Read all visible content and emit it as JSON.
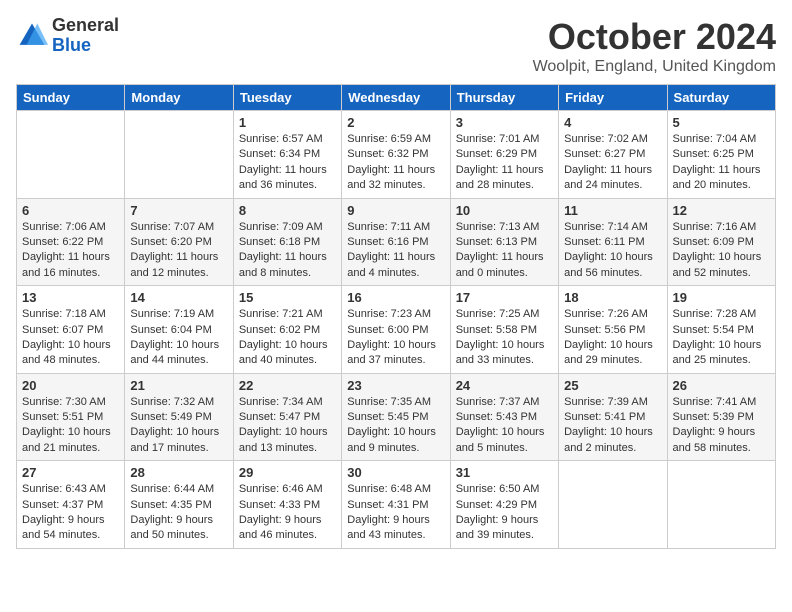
{
  "logo": {
    "general": "General",
    "blue": "Blue"
  },
  "title": {
    "month": "October 2024",
    "location": "Woolpit, England, United Kingdom"
  },
  "days_of_week": [
    "Sunday",
    "Monday",
    "Tuesday",
    "Wednesday",
    "Thursday",
    "Friday",
    "Saturday"
  ],
  "weeks": [
    [
      {
        "day": "",
        "info": ""
      },
      {
        "day": "",
        "info": ""
      },
      {
        "day": "1",
        "sunrise": "Sunrise: 6:57 AM",
        "sunset": "Sunset: 6:34 PM",
        "daylight": "Daylight: 11 hours and 36 minutes."
      },
      {
        "day": "2",
        "sunrise": "Sunrise: 6:59 AM",
        "sunset": "Sunset: 6:32 PM",
        "daylight": "Daylight: 11 hours and 32 minutes."
      },
      {
        "day": "3",
        "sunrise": "Sunrise: 7:01 AM",
        "sunset": "Sunset: 6:29 PM",
        "daylight": "Daylight: 11 hours and 28 minutes."
      },
      {
        "day": "4",
        "sunrise": "Sunrise: 7:02 AM",
        "sunset": "Sunset: 6:27 PM",
        "daylight": "Daylight: 11 hours and 24 minutes."
      },
      {
        "day": "5",
        "sunrise": "Sunrise: 7:04 AM",
        "sunset": "Sunset: 6:25 PM",
        "daylight": "Daylight: 11 hours and 20 minutes."
      }
    ],
    [
      {
        "day": "6",
        "sunrise": "Sunrise: 7:06 AM",
        "sunset": "Sunset: 6:22 PM",
        "daylight": "Daylight: 11 hours and 16 minutes."
      },
      {
        "day": "7",
        "sunrise": "Sunrise: 7:07 AM",
        "sunset": "Sunset: 6:20 PM",
        "daylight": "Daylight: 11 hours and 12 minutes."
      },
      {
        "day": "8",
        "sunrise": "Sunrise: 7:09 AM",
        "sunset": "Sunset: 6:18 PM",
        "daylight": "Daylight: 11 hours and 8 minutes."
      },
      {
        "day": "9",
        "sunrise": "Sunrise: 7:11 AM",
        "sunset": "Sunset: 6:16 PM",
        "daylight": "Daylight: 11 hours and 4 minutes."
      },
      {
        "day": "10",
        "sunrise": "Sunrise: 7:13 AM",
        "sunset": "Sunset: 6:13 PM",
        "daylight": "Daylight: 11 hours and 0 minutes."
      },
      {
        "day": "11",
        "sunrise": "Sunrise: 7:14 AM",
        "sunset": "Sunset: 6:11 PM",
        "daylight": "Daylight: 10 hours and 56 minutes."
      },
      {
        "day": "12",
        "sunrise": "Sunrise: 7:16 AM",
        "sunset": "Sunset: 6:09 PM",
        "daylight": "Daylight: 10 hours and 52 minutes."
      }
    ],
    [
      {
        "day": "13",
        "sunrise": "Sunrise: 7:18 AM",
        "sunset": "Sunset: 6:07 PM",
        "daylight": "Daylight: 10 hours and 48 minutes."
      },
      {
        "day": "14",
        "sunrise": "Sunrise: 7:19 AM",
        "sunset": "Sunset: 6:04 PM",
        "daylight": "Daylight: 10 hours and 44 minutes."
      },
      {
        "day": "15",
        "sunrise": "Sunrise: 7:21 AM",
        "sunset": "Sunset: 6:02 PM",
        "daylight": "Daylight: 10 hours and 40 minutes."
      },
      {
        "day": "16",
        "sunrise": "Sunrise: 7:23 AM",
        "sunset": "Sunset: 6:00 PM",
        "daylight": "Daylight: 10 hours and 37 minutes."
      },
      {
        "day": "17",
        "sunrise": "Sunrise: 7:25 AM",
        "sunset": "Sunset: 5:58 PM",
        "daylight": "Daylight: 10 hours and 33 minutes."
      },
      {
        "day": "18",
        "sunrise": "Sunrise: 7:26 AM",
        "sunset": "Sunset: 5:56 PM",
        "daylight": "Daylight: 10 hours and 29 minutes."
      },
      {
        "day": "19",
        "sunrise": "Sunrise: 7:28 AM",
        "sunset": "Sunset: 5:54 PM",
        "daylight": "Daylight: 10 hours and 25 minutes."
      }
    ],
    [
      {
        "day": "20",
        "sunrise": "Sunrise: 7:30 AM",
        "sunset": "Sunset: 5:51 PM",
        "daylight": "Daylight: 10 hours and 21 minutes."
      },
      {
        "day": "21",
        "sunrise": "Sunrise: 7:32 AM",
        "sunset": "Sunset: 5:49 PM",
        "daylight": "Daylight: 10 hours and 17 minutes."
      },
      {
        "day": "22",
        "sunrise": "Sunrise: 7:34 AM",
        "sunset": "Sunset: 5:47 PM",
        "daylight": "Daylight: 10 hours and 13 minutes."
      },
      {
        "day": "23",
        "sunrise": "Sunrise: 7:35 AM",
        "sunset": "Sunset: 5:45 PM",
        "daylight": "Daylight: 10 hours and 9 minutes."
      },
      {
        "day": "24",
        "sunrise": "Sunrise: 7:37 AM",
        "sunset": "Sunset: 5:43 PM",
        "daylight": "Daylight: 10 hours and 5 minutes."
      },
      {
        "day": "25",
        "sunrise": "Sunrise: 7:39 AM",
        "sunset": "Sunset: 5:41 PM",
        "daylight": "Daylight: 10 hours and 2 minutes."
      },
      {
        "day": "26",
        "sunrise": "Sunrise: 7:41 AM",
        "sunset": "Sunset: 5:39 PM",
        "daylight": "Daylight: 9 hours and 58 minutes."
      }
    ],
    [
      {
        "day": "27",
        "sunrise": "Sunrise: 6:43 AM",
        "sunset": "Sunset: 4:37 PM",
        "daylight": "Daylight: 9 hours and 54 minutes."
      },
      {
        "day": "28",
        "sunrise": "Sunrise: 6:44 AM",
        "sunset": "Sunset: 4:35 PM",
        "daylight": "Daylight: 9 hours and 50 minutes."
      },
      {
        "day": "29",
        "sunrise": "Sunrise: 6:46 AM",
        "sunset": "Sunset: 4:33 PM",
        "daylight": "Daylight: 9 hours and 46 minutes."
      },
      {
        "day": "30",
        "sunrise": "Sunrise: 6:48 AM",
        "sunset": "Sunset: 4:31 PM",
        "daylight": "Daylight: 9 hours and 43 minutes."
      },
      {
        "day": "31",
        "sunrise": "Sunrise: 6:50 AM",
        "sunset": "Sunset: 4:29 PM",
        "daylight": "Daylight: 9 hours and 39 minutes."
      },
      {
        "day": "",
        "info": ""
      },
      {
        "day": "",
        "info": ""
      }
    ]
  ]
}
